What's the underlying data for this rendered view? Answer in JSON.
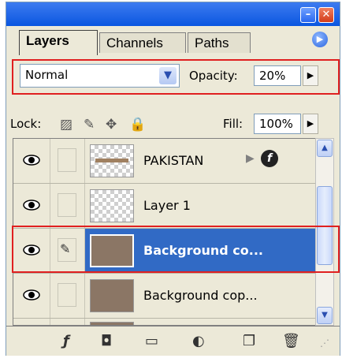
{
  "window": {
    "minimize_symbol": "–",
    "close_symbol": "✕"
  },
  "tabs": [
    {
      "label": "Layers",
      "active": true
    },
    {
      "label": "Channels",
      "active": false
    },
    {
      "label": "Paths",
      "active": false
    }
  ],
  "options": {
    "blend_mode": "Normal",
    "opacity_label": "Opacity:",
    "opacity_value": "20%",
    "lock_label": "Lock:",
    "fill_label": "Fill:",
    "fill_value": "100%"
  },
  "layers": [
    {
      "name": "PAKISTAN",
      "thumbnail": "transparent-checker-with-text",
      "visible": true,
      "selected": false,
      "has_effects": true
    },
    {
      "name": "Layer 1",
      "thumbnail": "transparent-checker",
      "visible": true,
      "selected": false
    },
    {
      "name": "Background co...",
      "thumbnail": "brown-fill",
      "visible": true,
      "selected": true,
      "brush_linked": true
    },
    {
      "name": "Background cop...",
      "thumbnail": "brown-fill",
      "visible": true,
      "selected": false
    }
  ],
  "colors": {
    "titlebar": "#0a56e0",
    "selection": "#316ac5",
    "layer_fill": "#8b7665",
    "highlight_box": "#e02020",
    "panel_bg": "#ece9d8"
  },
  "bottom_icons": [
    "layer-style-icon",
    "layer-mask-icon",
    "new-group-icon",
    "adjustment-layer-icon",
    "new-layer-icon",
    "delete-layer-icon"
  ]
}
